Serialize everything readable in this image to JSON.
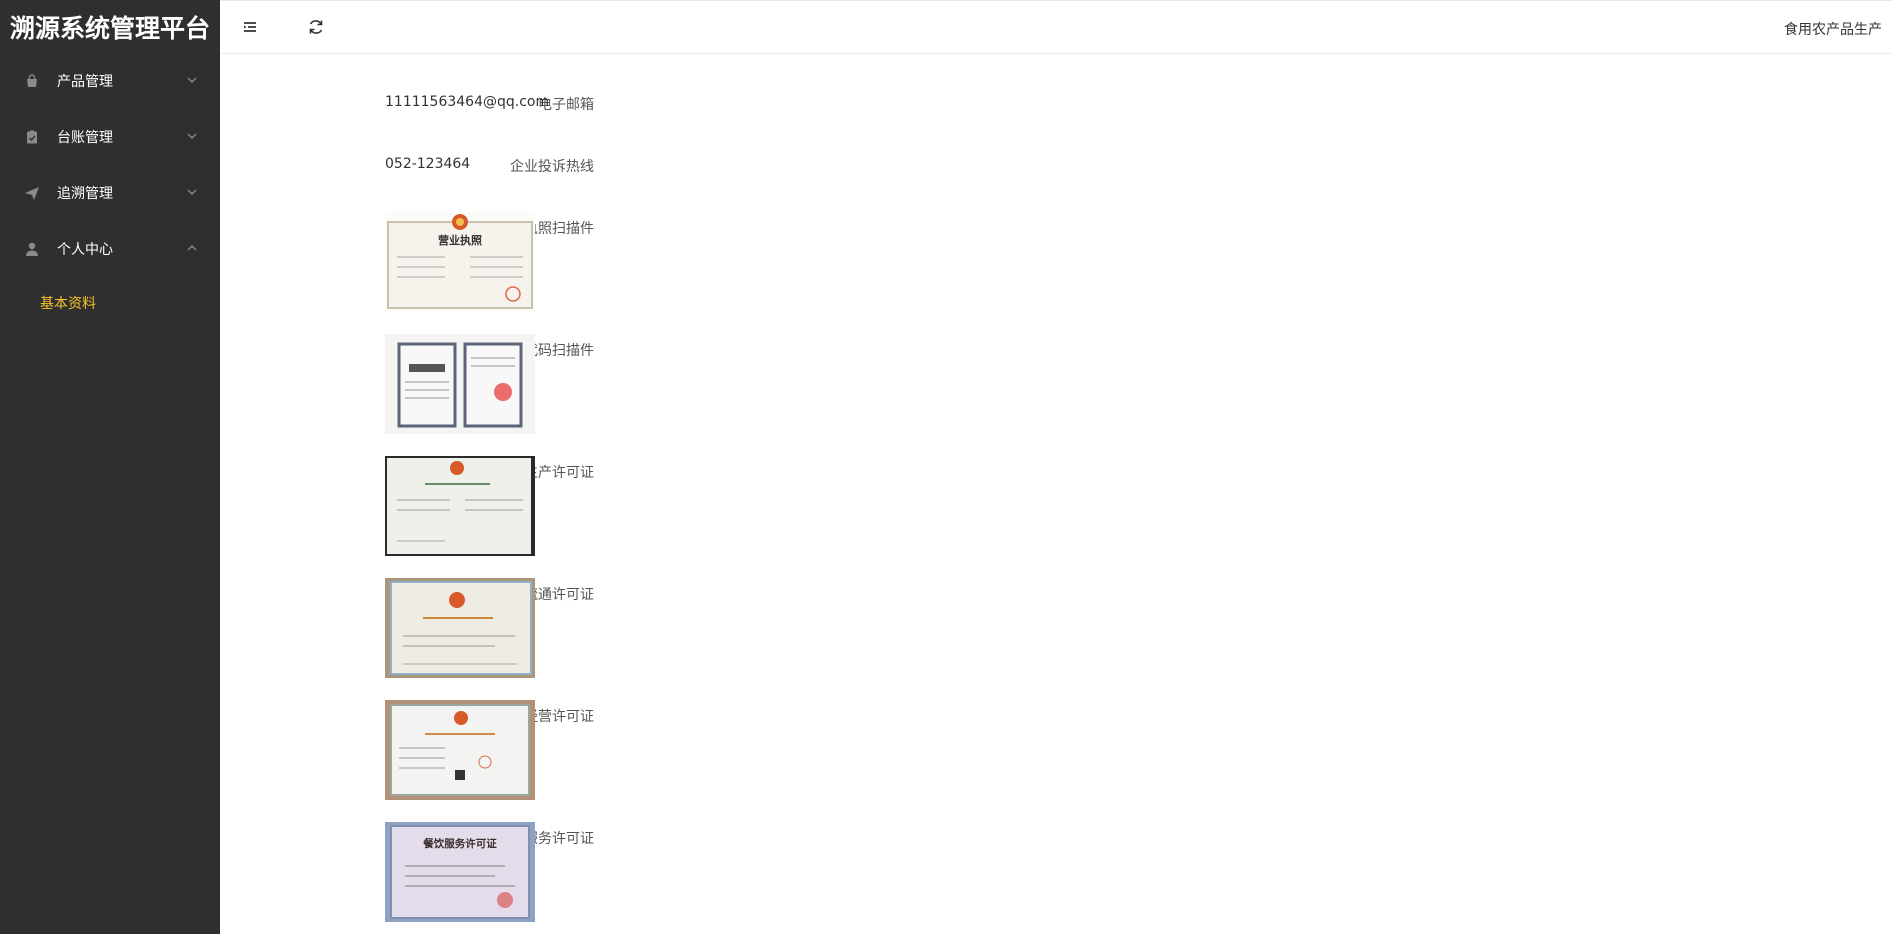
{
  "app": {
    "title": "溯源系统管理平台"
  },
  "sidebar": {
    "items": [
      {
        "label": "产品管理",
        "icon": "bag-icon",
        "expanded": false
      },
      {
        "label": "台账管理",
        "icon": "clipboard-check-icon",
        "expanded": false
      },
      {
        "label": "追溯管理",
        "icon": "paper-plane-icon",
        "expanded": false
      },
      {
        "label": "个人中心",
        "icon": "user-icon",
        "expanded": true
      }
    ],
    "submenu": {
      "label": "基本资料",
      "active_color": "#f7c02b"
    }
  },
  "topbar": {
    "user": "食用农产品生产"
  },
  "profile": {
    "email_label": "电子邮箱",
    "email_value": "11111563464@qq.com",
    "hotline_label": "企业投诉热线",
    "hotline_value": "052-123464",
    "documents": [
      {
        "label": "营业执照扫描件",
        "doc_title": "营业执照"
      },
      {
        "label": "组织机构代码扫描件",
        "doc_title": ""
      },
      {
        "label": "食品生产许可证",
        "doc_title": ""
      },
      {
        "label": "食品流通许可证",
        "doc_title": ""
      },
      {
        "label": "食品经营许可证",
        "doc_title": ""
      },
      {
        "label": "餐饮服务许可证",
        "doc_title": "餐饮服务许可证"
      }
    ]
  },
  "colors": {
    "sidebar_bg": "#2f2f2f",
    "accent": "#f7c02b"
  }
}
